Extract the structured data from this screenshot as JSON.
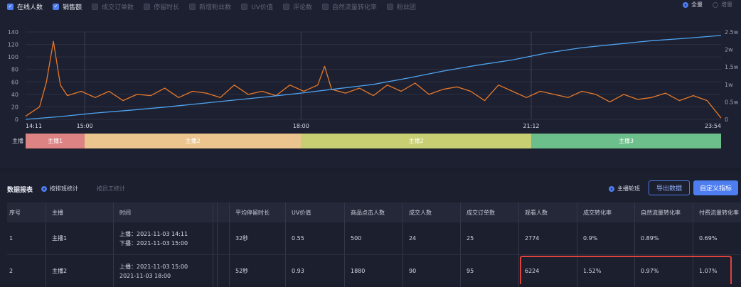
{
  "filters": [
    {
      "label": "在线人数",
      "checked": true
    },
    {
      "label": "销售额",
      "checked": true
    },
    {
      "label": "成交订单数",
      "checked": false
    },
    {
      "label": "停留时长",
      "checked": false
    },
    {
      "label": "新增粉丝数",
      "checked": false
    },
    {
      "label": "UV价值",
      "checked": false
    },
    {
      "label": "评论数",
      "checked": false
    },
    {
      "label": "自然流量转化率",
      "checked": false
    },
    {
      "label": "粉丝团",
      "checked": false
    }
  ],
  "mode": {
    "all": "全量",
    "increment": "增量"
  },
  "chart_data": {
    "type": "line",
    "x_ticks": [
      "14:11",
      "15:00",
      "18:00",
      "21:12",
      "23:54"
    ],
    "left_axis": {
      "ticks": [
        "0",
        "20",
        "40",
        "60",
        "80",
        "100",
        "120",
        "140"
      ],
      "range": [
        0,
        140
      ]
    },
    "right_axis": {
      "ticks": [
        "0",
        "0.5w",
        "1w",
        "1.5w",
        "2w",
        "2.5w"
      ],
      "range": [
        0,
        25000
      ]
    },
    "series": [
      {
        "color": "#e8792a",
        "axis": "left",
        "x": [
          0,
          0.02,
          0.03,
          0.04,
          0.05,
          0.06,
          0.08,
          0.1,
          0.12,
          0.14,
          0.16,
          0.18,
          0.2,
          0.22,
          0.24,
          0.26,
          0.28,
          0.3,
          0.32,
          0.34,
          0.36,
          0.38,
          0.4,
          0.42,
          0.43,
          0.44,
          0.46,
          0.48,
          0.5,
          0.52,
          0.54,
          0.56,
          0.58,
          0.6,
          0.62,
          0.64,
          0.66,
          0.68,
          0.7,
          0.72,
          0.74,
          0.76,
          0.78,
          0.8,
          0.82,
          0.84,
          0.86,
          0.88,
          0.9,
          0.92,
          0.94,
          0.96,
          0.98,
          1.0
        ],
        "values": [
          5,
          20,
          60,
          125,
          55,
          38,
          45,
          35,
          45,
          30,
          40,
          38,
          50,
          35,
          45,
          42,
          35,
          55,
          40,
          45,
          38,
          55,
          45,
          55,
          85,
          48,
          42,
          50,
          38,
          55,
          45,
          58,
          40,
          48,
          52,
          45,
          30,
          55,
          45,
          35,
          45,
          40,
          35,
          45,
          40,
          28,
          40,
          32,
          35,
          42,
          30,
          38,
          30,
          2
        ]
      },
      {
        "color": "#4ea3f0",
        "axis": "right",
        "x": [
          0,
          0.05,
          0.1,
          0.15,
          0.2,
          0.25,
          0.3,
          0.35,
          0.4,
          0.45,
          0.5,
          0.55,
          0.6,
          0.65,
          0.7,
          0.75,
          0.8,
          0.85,
          0.9,
          0.95,
          1.0
        ],
        "values": [
          0,
          800,
          1800,
          2600,
          3500,
          4500,
          5500,
          6500,
          7600,
          8800,
          10000,
          11800,
          13800,
          15500,
          17000,
          19000,
          20500,
          21500,
          22500,
          23200,
          24000
        ]
      }
    ]
  },
  "anchor_bar": {
    "label": "主播",
    "segments": [
      {
        "name": "主播1",
        "start": 0,
        "end": 0.085,
        "color": "#dd8383"
      },
      {
        "name": "主播2",
        "start": 0.085,
        "end": 0.396,
        "color": "#ecc48d"
      },
      {
        "name": "主播2",
        "start": 0.396,
        "end": 0.727,
        "color": "#c8cf72"
      },
      {
        "name": "主播3",
        "start": 0.727,
        "end": 1.0,
        "color": "#6cbe8a"
      }
    ]
  },
  "report": {
    "title": "数据报表",
    "by_anchor": "按排班统计",
    "by_staff": "按员工统计",
    "rotate": "主播轮班",
    "export": "导出数据",
    "custom": "自定义指标"
  },
  "table": {
    "headers": [
      "序号",
      "主播",
      "时间",
      "平均停留时长",
      "UV价值",
      "商品点击人数",
      "成交人数",
      "成交订单数",
      "观看人数",
      "成交转化率",
      "自然流量转化率",
      "付费流量转化率"
    ],
    "rows": [
      {
        "idx": "1",
        "anchor": "主播1",
        "time1": "上播：2021-11-03 14:11",
        "time2": "下播：2021-11-03 15:00",
        "stay": "32秒",
        "uv": "0.55",
        "clicks": "500",
        "buyers": "24",
        "orders": "25",
        "viewers": "2774",
        "conv": "0.9%",
        "natural": "0.89%",
        "paid": "0.69%"
      },
      {
        "idx": "2",
        "anchor": "主播2",
        "time1": "上播：2021-11-03 15:00",
        "time2": "2021-11-03 18:00",
        "stay": "52秒",
        "uv": "0.93",
        "clicks": "1880",
        "buyers": "90",
        "orders": "95",
        "viewers": "6224",
        "conv": "1.52%",
        "natural": "0.97%",
        "paid": "1.07%"
      }
    ]
  }
}
